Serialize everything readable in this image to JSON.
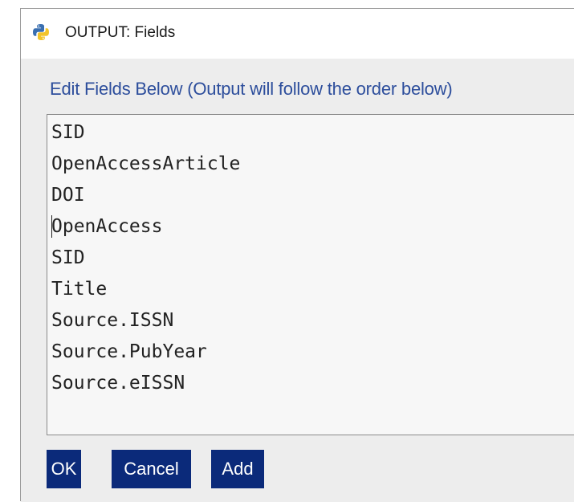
{
  "window": {
    "title": "OUTPUT: Fields",
    "app_icon": "python-logo-icon"
  },
  "editor": {
    "header": "Edit Fields Below (Output will follow the order below)",
    "lines": [
      "SID",
      "OpenAccessArticle",
      "DOI",
      "OpenAccess",
      "SID",
      "Title",
      "Source.ISSN",
      "Source.PubYear",
      "Source.eISSN"
    ]
  },
  "buttons": {
    "ok": "OK",
    "cancel": "Cancel",
    "add": "Add"
  },
  "colors": {
    "header_text": "#2d4e9c",
    "button_bg": "#0b2a7a",
    "button_text": "#ffffff",
    "client_bg": "#ededed"
  }
}
